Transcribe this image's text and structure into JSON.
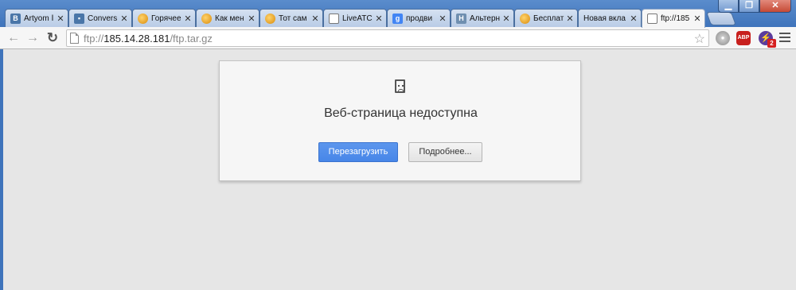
{
  "tabs": [
    {
      "label": "Artyom Ⅰ",
      "favicon": "vk-icon"
    },
    {
      "label": "Convers",
      "favicon": "speech-bubble-icon"
    },
    {
      "label": "Горячее",
      "favicon": "orange-ball-icon"
    },
    {
      "label": "Как мен",
      "favicon": "orange-ball-icon"
    },
    {
      "label": "Тот сам",
      "favicon": "orange-ball-icon"
    },
    {
      "label": "LiveATC",
      "favicon": "document-icon"
    },
    {
      "label": "продви",
      "favicon": "google-icon"
    },
    {
      "label": "Альтерн",
      "favicon": "habr-icon"
    },
    {
      "label": "Бесплат",
      "favicon": "orange-ball-icon"
    },
    {
      "label": "Новая вкла",
      "favicon": ""
    },
    {
      "label": "ftp://185",
      "favicon": "document-icon",
      "active": true
    }
  ],
  "window_controls": {
    "minimize": "▁",
    "maximize": "❐",
    "close": "✕"
  },
  "toolbar": {
    "back": "←",
    "forward": "→",
    "reload": "↻",
    "url_scheme": "ftp://",
    "url_host": "185.14.28.181",
    "url_path": "/ftp.tar.gz",
    "star": "☆",
    "extensions": {
      "abp_label": "ABP",
      "sync_badge": "2"
    }
  },
  "error": {
    "title": "Веб-страница недоступна",
    "reload_button": "Перезагрузить",
    "details_button": "Подробнее..."
  },
  "colors": {
    "titlebar": "#3f74bb",
    "primary_button": "#4786e8",
    "background": "#e6e6e6"
  }
}
